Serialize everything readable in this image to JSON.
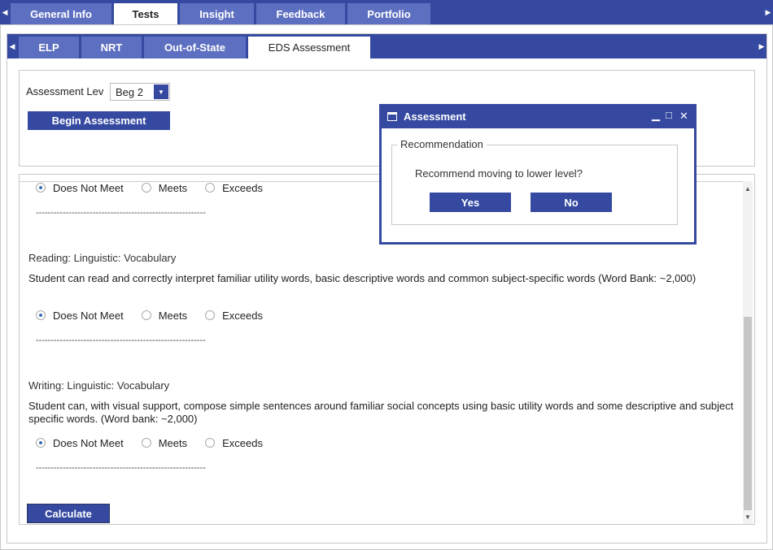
{
  "top_tabs": {
    "left_arrow": "◀",
    "right_arrow": "▶",
    "items": [
      {
        "label": "General Info"
      },
      {
        "label": "Tests",
        "active": true
      },
      {
        "label": "Insight"
      },
      {
        "label": "Feedback"
      },
      {
        "label": "Portfolio"
      }
    ]
  },
  "sub_tabs": {
    "left_arrow": "◀",
    "right_arrow": "▶",
    "items": [
      {
        "label": "ELP"
      },
      {
        "label": "NRT"
      },
      {
        "label": "Out-of-State"
      },
      {
        "label": "EDS Assessment",
        "active": true
      }
    ]
  },
  "assessment": {
    "level_label": "Assessment Lev",
    "level_value": "Beg 2",
    "dropdown_arrow": "▼",
    "begin_button": "Begin Assessment"
  },
  "options": {
    "does_not_meet": "Does Not Meet",
    "meets": "Meets",
    "exceeds": "Exceeds"
  },
  "sections": [
    {
      "title": "",
      "description": "",
      "selected": "Does Not Meet",
      "separator": "---------------------------------------------------------"
    },
    {
      "title": "Reading: Linguistic: Vocabulary",
      "description": "Student can read and correctly interpret familiar utility words, basic descriptive words and common subject-specific words (Word Bank: ~2,000)",
      "selected": "Does Not Meet",
      "separator": "---------------------------------------------------------"
    },
    {
      "title": "Writing: Linguistic: Vocabulary",
      "description": "Student can, with visual support, compose simple sentences around familiar social concepts using basic utility words and some descriptive and subject specific words. (Word bank: ~2,000)",
      "selected": "Does Not Meet",
      "separator": "---------------------------------------------------------"
    }
  ],
  "calculate_button": "Calculate",
  "scrollbar": {
    "up": "▲",
    "down": "▼"
  },
  "dialog": {
    "title": "Assessment",
    "minimize": "▁",
    "maximize": "□",
    "close": "✕",
    "legend": "Recommendation",
    "message": "Recommend moving to lower level?",
    "yes_label": "Yes",
    "no_label": "No"
  },
  "colors": {
    "primary": "#3549a1",
    "tab_inactive": "#5d6fc0",
    "radio_dot": "#3a6fb8"
  }
}
